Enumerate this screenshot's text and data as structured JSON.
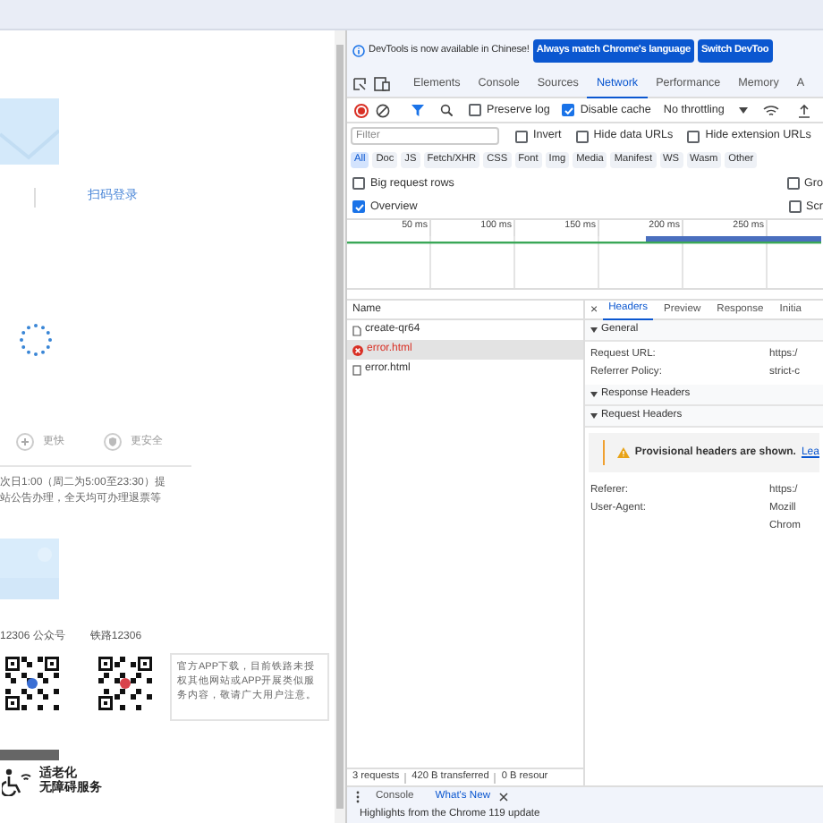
{
  "page": {
    "qr_login_label": "扫码登录",
    "features": [
      {
        "label": "更快",
        "kind": "plus"
      },
      {
        "label": "更安全",
        "kind": "shield"
      }
    ],
    "notice_lines": [
      "次日1:00（周二为5:00至23:30）提",
      "站公告办理，全天均可办理退票等"
    ],
    "qr_codes": [
      {
        "caption": "12306 公众号",
        "color": "#3b6fd4"
      },
      {
        "caption": "铁路12306",
        "color": "#d9434b"
      }
    ],
    "app_notice": "官方APP下载，目前铁路未授权其他网站或APP开展类似服务内容，敬请广大用户注意。",
    "accessibility": [
      "适老化",
      "无障碍服务"
    ]
  },
  "devtools": {
    "banner": {
      "message": "DevTools is now available in Chinese!",
      "buttons": [
        "Always match Chrome's language",
        "Switch DevToo"
      ]
    },
    "tabs": [
      {
        "label": "Elements",
        "selected": false
      },
      {
        "label": "Console",
        "selected": false
      },
      {
        "label": "Sources",
        "selected": false
      },
      {
        "label": "Network",
        "selected": true
      },
      {
        "label": "Performance",
        "selected": false
      },
      {
        "label": "Memory",
        "selected": false
      },
      {
        "label": "A",
        "selected": false
      }
    ],
    "toolbar": {
      "options": [
        {
          "label": "Preserve log",
          "checked": false
        },
        {
          "label": "Disable cache",
          "checked": true
        }
      ],
      "throttling": "No throttling"
    },
    "filter": {
      "placeholder": "Filter",
      "options": [
        {
          "label": "Invert",
          "checked": false
        },
        {
          "label": "Hide data URLs",
          "checked": false
        },
        {
          "label": "Hide extension URLs",
          "checked": false
        }
      ]
    },
    "types": [
      {
        "label": "All",
        "selected": true
      },
      {
        "label": "Doc",
        "selected": false
      },
      {
        "label": "JS",
        "selected": false
      },
      {
        "label": "Fetch/XHR",
        "selected": false
      },
      {
        "label": "CSS",
        "selected": false
      },
      {
        "label": "Font",
        "selected": false
      },
      {
        "label": "Img",
        "selected": false
      },
      {
        "label": "Media",
        "selected": false
      },
      {
        "label": "Manifest",
        "selected": false
      },
      {
        "label": "WS",
        "selected": false
      },
      {
        "label": "Wasm",
        "selected": false
      },
      {
        "label": "Other",
        "selected": false
      }
    ],
    "settings": [
      {
        "left": {
          "label": "Big request rows",
          "checked": false
        },
        "right": {
          "label": "Gro",
          "checked": false
        }
      },
      {
        "left": {
          "label": "Overview",
          "checked": true
        },
        "right": {
          "label": "Scr",
          "checked": false
        }
      }
    ],
    "timeline_ticks": [
      "50 ms",
      "100 ms",
      "150 ms",
      "200 ms",
      "250 ms"
    ],
    "name_header": "Name",
    "requests": [
      {
        "name": "create-qr64",
        "kind": "document",
        "selected": false
      },
      {
        "name": "error.html",
        "kind": "error",
        "selected": true
      },
      {
        "name": "error.html",
        "kind": "blank",
        "selected": false
      }
    ],
    "detail_close": "×",
    "detail_tabs": [
      {
        "label": "Headers",
        "selected": true
      },
      {
        "label": "Preview",
        "selected": false
      },
      {
        "label": "Response",
        "selected": false
      },
      {
        "label": "Initia",
        "selected": false
      }
    ],
    "sections": [
      {
        "title": "General",
        "rows": [
          {
            "key": "Request URL:",
            "values": [
              "https:/"
            ]
          },
          {
            "key": "Referrer Policy:",
            "values": [
              "strict-c"
            ]
          }
        ]
      },
      {
        "title": "Response Headers"
      },
      {
        "title": "Request Headers",
        "warning": {
          "text": "Provisional headers are shown.",
          "link": "Lea"
        },
        "rows": [
          {
            "key": "Referer:",
            "values": [
              "https:/"
            ]
          },
          {
            "key": "User-Agent:",
            "values": [
              "Mozill",
              "Chrom"
            ]
          }
        ]
      }
    ],
    "status": [
      "3 requests",
      "420 B transferred",
      "0 B resour"
    ],
    "drawer": {
      "tabs": [
        {
          "label": "Console",
          "selected": false
        },
        {
          "label": "What's New",
          "selected": true
        }
      ],
      "content": "Highlights from the Chrome 119 update"
    }
  }
}
